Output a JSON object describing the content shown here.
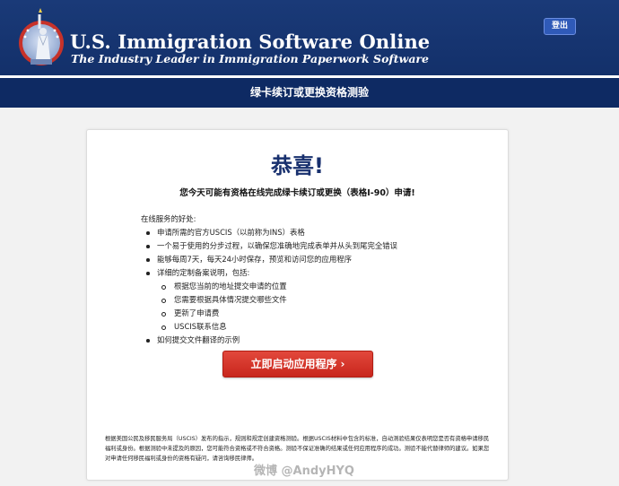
{
  "header": {
    "title": "U.S. Immigration Software Online",
    "tagline": "The Industry Leader in Immigration Paperwork Software",
    "logout_label": "登出",
    "bg_color": "#1a3a78",
    "logo_icon": "statue-of-liberty-seal"
  },
  "subheader": {
    "title": "绿卡续订或更换资格测验"
  },
  "card": {
    "heading": "恭喜!",
    "eligibility": "您今天可能有资格在线完成绿卡续订或更换（表格I-90）申请!",
    "benefits_title": "在线服务的好处:",
    "benefits": [
      "申请所需的官方USCIS（以前称为INS）表格",
      "一个易于使用的分步过程，以确保您准确地完成表单并从头到尾完全错误",
      "能够每周7天，每天24小时保存，预览和访问您的应用程序",
      "详细的定制备案说明，包括:"
    ],
    "sub_benefits": [
      "根据您当前的地址提交申请的位置",
      "您需要根据具体情况提交哪些文件",
      "更新了申请费",
      "USCIS联系信息"
    ],
    "last_benefit": "如何提交文件翻译的示例",
    "start_button": "立即启动应用程序",
    "start_button_color": "#d3342a",
    "disclaimer": "根据美国公民及移民服务局（USCIS）发布的指示，规则和规定创建资格测验。根据USCIS材料中包含的标准，自动测验结果仅表明您是否有资格申请移民福利或身份。根据测验中未提及的原因，您可能符合资格或不符合资格。测验不保证准确的结果或任何应用程序的成功。测验不能代替律师的建议。如果您对申请任何移民福利或身份的资格有疑问，请咨询移民律师。"
  },
  "watermark": "微博 @AndyHYQ"
}
